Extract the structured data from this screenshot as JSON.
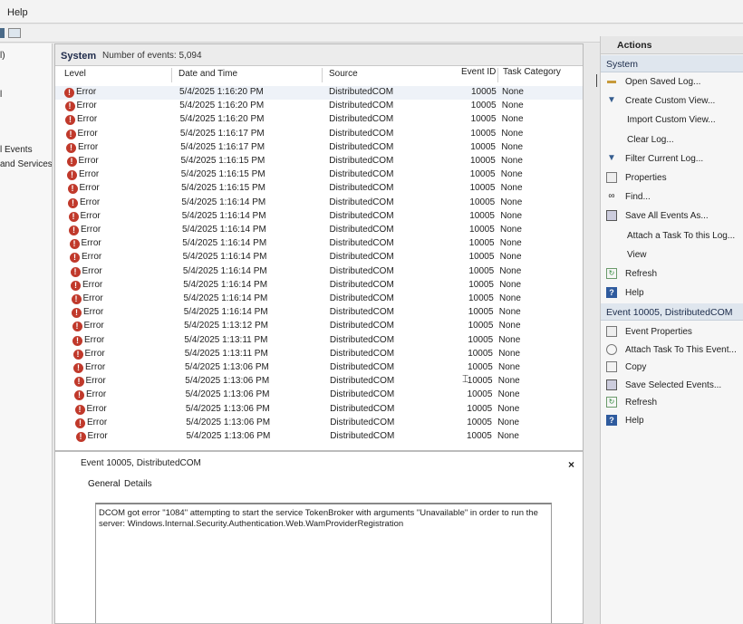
{
  "menubar": {
    "help": "Help"
  },
  "tree": {
    "partial_top": "l)",
    "partial_mid": "l",
    "item_events": "l Events",
    "item_services": "and Services Lo"
  },
  "center": {
    "title": "System",
    "count": "Number of events: 5,094",
    "columns": {
      "level": "Level",
      "date": "Date and Time",
      "source": "Source",
      "event_id": "Event ID",
      "task": "Task Category"
    },
    "rows": [
      {
        "level": "Error",
        "date": "5/4/2025 1:16:20 PM",
        "source": "DistributedCOM",
        "event_id": "10005",
        "task": "None"
      },
      {
        "level": "Error",
        "date": "5/4/2025 1:16:20 PM",
        "source": "DistributedCOM",
        "event_id": "10005",
        "task": "None"
      },
      {
        "level": "Error",
        "date": "5/4/2025 1:16:20 PM",
        "source": "DistributedCOM",
        "event_id": "10005",
        "task": "None"
      },
      {
        "level": "Error",
        "date": "5/4/2025 1:16:17 PM",
        "source": "DistributedCOM",
        "event_id": "10005",
        "task": "None"
      },
      {
        "level": "Error",
        "date": "5/4/2025 1:16:17 PM",
        "source": "DistributedCOM",
        "event_id": "10005",
        "task": "None"
      },
      {
        "level": "Error",
        "date": "5/4/2025 1:16:15 PM",
        "source": "DistributedCOM",
        "event_id": "10005",
        "task": "None"
      },
      {
        "level": "Error",
        "date": "5/4/2025 1:16:15 PM",
        "source": "DistributedCOM",
        "event_id": "10005",
        "task": "None"
      },
      {
        "level": "Error",
        "date": "5/4/2025 1:16:15 PM",
        "source": "DistributedCOM",
        "event_id": "10005",
        "task": "None"
      },
      {
        "level": "Error",
        "date": "5/4/2025 1:16:14 PM",
        "source": "DistributedCOM",
        "event_id": "10005",
        "task": "None"
      },
      {
        "level": "Error",
        "date": "5/4/2025 1:16:14 PM",
        "source": "DistributedCOM",
        "event_id": "10005",
        "task": "None"
      },
      {
        "level": "Error",
        "date": "5/4/2025 1:16:14 PM",
        "source": "DistributedCOM",
        "event_id": "10005",
        "task": "None"
      },
      {
        "level": "Error",
        "date": "5/4/2025 1:16:14 PM",
        "source": "DistributedCOM",
        "event_id": "10005",
        "task": "None"
      },
      {
        "level": "Error",
        "date": "5/4/2025 1:16:14 PM",
        "source": "DistributedCOM",
        "event_id": "10005",
        "task": "None"
      },
      {
        "level": "Error",
        "date": "5/4/2025 1:16:14 PM",
        "source": "DistributedCOM",
        "event_id": "10005",
        "task": "None"
      },
      {
        "level": "Error",
        "date": "5/4/2025 1:16:14 PM",
        "source": "DistributedCOM",
        "event_id": "10005",
        "task": "None"
      },
      {
        "level": "Error",
        "date": "5/4/2025 1:16:14 PM",
        "source": "DistributedCOM",
        "event_id": "10005",
        "task": "None"
      },
      {
        "level": "Error",
        "date": "5/4/2025 1:16:14 PM",
        "source": "DistributedCOM",
        "event_id": "10005",
        "task": "None"
      },
      {
        "level": "Error",
        "date": "5/4/2025 1:13:12 PM",
        "source": "DistributedCOM",
        "event_id": "10005",
        "task": "None"
      },
      {
        "level": "Error",
        "date": "5/4/2025 1:13:11 PM",
        "source": "DistributedCOM",
        "event_id": "10005",
        "task": "None"
      },
      {
        "level": "Error",
        "date": "5/4/2025 1:13:11 PM",
        "source": "DistributedCOM",
        "event_id": "10005",
        "task": "None"
      },
      {
        "level": "Error",
        "date": "5/4/2025 1:13:06 PM",
        "source": "DistributedCOM",
        "event_id": "10005",
        "task": "None"
      },
      {
        "level": "Error",
        "date": "5/4/2025 1:13:06 PM",
        "source": "DistributedCOM",
        "event_id": "10005",
        "task": "None"
      },
      {
        "level": "Error",
        "date": "5/4/2025 1:13:06 PM",
        "source": "DistributedCOM",
        "event_id": "10005",
        "task": "None"
      },
      {
        "level": "Error",
        "date": "5/4/2025 1:13:06 PM",
        "source": "DistributedCOM",
        "event_id": "10005",
        "task": "None"
      },
      {
        "level": "Error",
        "date": "5/4/2025 1:13:06 PM",
        "source": "DistributedCOM",
        "event_id": "10005",
        "task": "None"
      },
      {
        "level": "Error",
        "date": "5/4/2025 1:13:06 PM",
        "source": "DistributedCOM",
        "event_id": "10005",
        "task": "None"
      }
    ]
  },
  "detail": {
    "title": "Event 10005, DistributedCOM",
    "close": "×",
    "tab_general": "General",
    "tab_details": "Details",
    "message": "DCOM got error \"1084\" attempting to start the service TokenBroker with arguments \"Unavailable\" in order to run the server: Windows.Internal.Security.Authentication.Web.WamProviderRegistration"
  },
  "actions": {
    "title": "Actions",
    "section_system": "System",
    "system_items": [
      {
        "label": "Open Saved Log...",
        "icon": "folder-icon"
      },
      {
        "label": "Create Custom View...",
        "icon": "funnel-icon"
      },
      {
        "label": "Import Custom View...",
        "icon": ""
      },
      {
        "label": "Clear Log...",
        "icon": ""
      },
      {
        "label": "Filter Current Log...",
        "icon": "funnel-icon"
      },
      {
        "label": "Properties",
        "icon": "properties-icon"
      },
      {
        "label": "Find...",
        "icon": "binoculars-icon"
      },
      {
        "label": "Save All Events As...",
        "icon": "save-icon"
      },
      {
        "label": "Attach a Task To this Log...",
        "icon": ""
      },
      {
        "label": "View",
        "icon": ""
      },
      {
        "label": "Refresh",
        "icon": "refresh-icon"
      },
      {
        "label": "Help",
        "icon": "help-icon"
      }
    ],
    "section_event": "Event 10005, DistributedCOM",
    "event_items": [
      {
        "label": "Event Properties",
        "icon": "properties-icon"
      },
      {
        "label": "Attach Task To This Event...",
        "icon": "task-icon"
      },
      {
        "label": "Copy",
        "icon": "copy-icon"
      },
      {
        "label": "Save Selected Events...",
        "icon": "save-icon"
      },
      {
        "label": "Refresh",
        "icon": "refresh-icon"
      },
      {
        "label": "Help",
        "icon": "help-icon"
      }
    ]
  }
}
